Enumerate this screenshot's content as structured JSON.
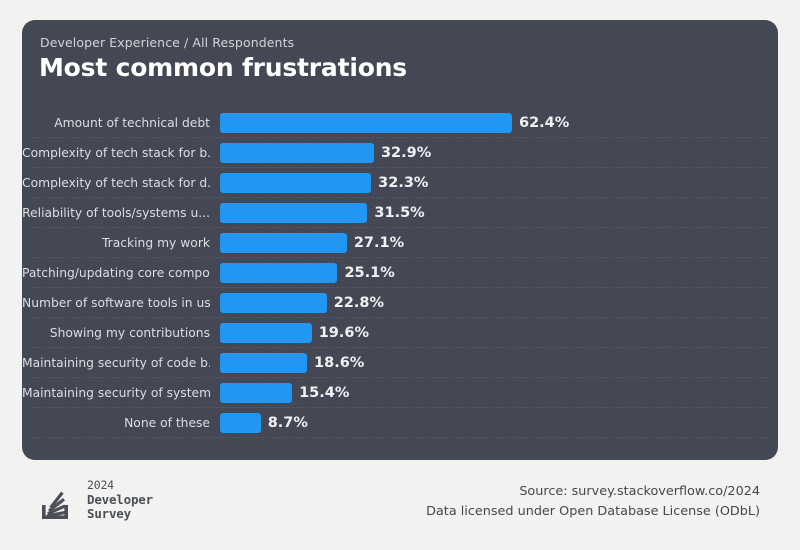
{
  "card": {
    "breadcrumb": "Developer Experience / All Respondents",
    "title": "Most common frustrations",
    "background_color": "#434854",
    "bar_color": "#2196f3"
  },
  "page": {
    "background_color": "#f2f2f0"
  },
  "footer": {
    "logo": {
      "icon": "stack-overflow-survey-logo",
      "year": "2024",
      "line1": "Developer",
      "line2": "Survey"
    },
    "source_line1": "Source: survey.stackoverflow.co/2024",
    "source_line2": "Data licensed under Open Database License (ODbL)"
  },
  "chart_data": {
    "type": "bar",
    "orientation": "horizontal",
    "title": "Most common frustrations",
    "subtitle": "Developer Experience / All Respondents",
    "xlabel": "",
    "ylabel": "",
    "xlim": [
      0,
      62.4
    ],
    "grid": true,
    "legend": null,
    "value_suffix": "%",
    "categories": [
      "Amount of technical debt",
      "Complexity of tech stack for b...",
      "Complexity of tech stack for d...",
      "Reliability of tools/systems u...",
      "Tracking my work",
      "Patching/updating core compone...",
      "Number of software tools in us...",
      "Showing my contributions",
      "Maintaining security of code b...",
      "Maintaining security of system...",
      "None of these"
    ],
    "values": [
      62.4,
      32.9,
      32.3,
      31.5,
      27.1,
      25.1,
      22.8,
      19.6,
      18.6,
      15.4,
      8.7
    ],
    "value_labels": [
      "62.4%",
      "32.9%",
      "32.3%",
      "31.5%",
      "27.1%",
      "25.1%",
      "22.8%",
      "19.6%",
      "18.6%",
      "15.4%",
      "8.7%"
    ]
  }
}
